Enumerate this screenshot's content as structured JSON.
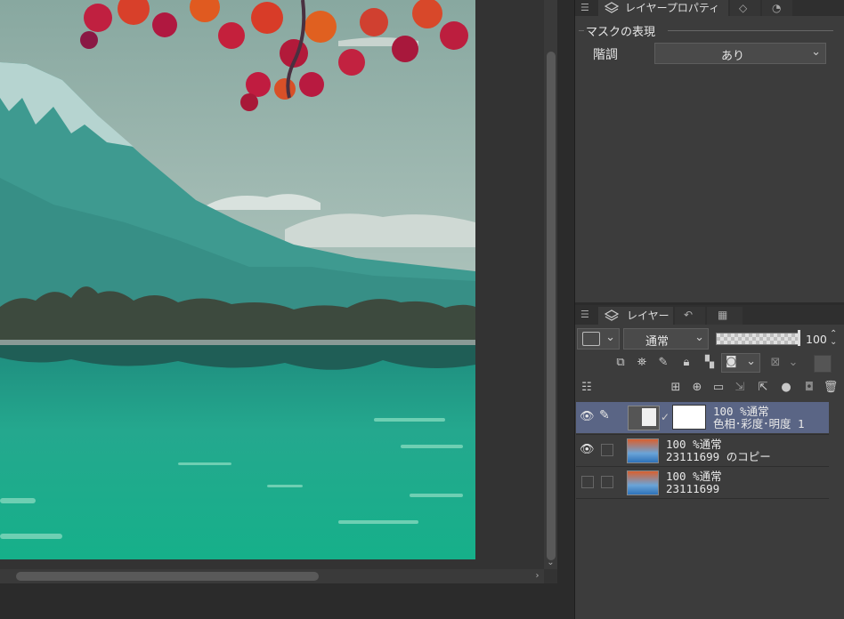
{
  "property_panel": {
    "tab_title": "レイヤープロパティ",
    "section_title": "マスクの表現",
    "gradation_label": "階調",
    "gradation_value": "あり"
  },
  "layer_panel": {
    "tab_title": "レイヤー",
    "blend_mode": "通常",
    "opacity": "100",
    "layers": [
      {
        "opacity_mode": "100 %通常",
        "name": "色相･彩度･明度 1",
        "visible": true,
        "selected": true
      },
      {
        "opacity_mode": "100 %通常",
        "name": "23111699 のコピー",
        "visible": true,
        "selected": false
      },
      {
        "opacity_mode": "100 %通常",
        "name": "23111699",
        "visible": false,
        "selected": false
      }
    ]
  },
  "colors": {
    "panel_bg": "#3c3c3c",
    "selected_row": "#5a6585",
    "canvas_bg": "#333333"
  }
}
